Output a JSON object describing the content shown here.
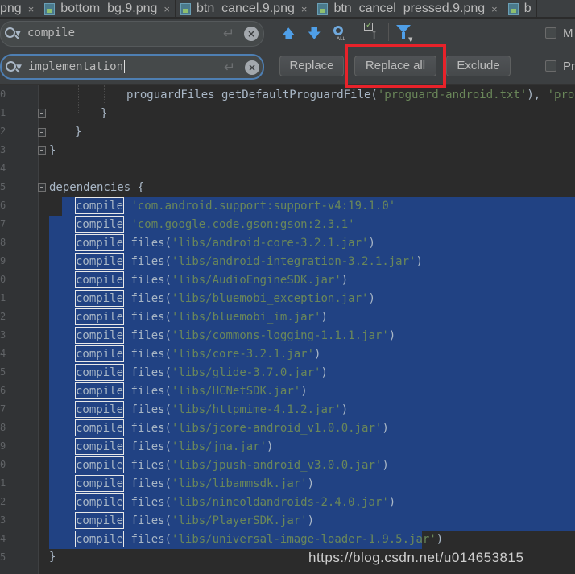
{
  "tabs": [
    {
      "label": "png",
      "has_icon": false
    },
    {
      "label": "bottom_bg.9.png",
      "has_icon": true
    },
    {
      "label": "btn_cancel.9.png",
      "has_icon": true
    },
    {
      "label": "btn_cancel_pressed.9.png",
      "has_icon": true
    },
    {
      "label": "b",
      "has_icon": true
    }
  ],
  "search": {
    "find_value": "compile",
    "replace_value": "implementation",
    "replace_button": "Replace",
    "replace_all_button": "Replace all",
    "exclude_button": "Exclude",
    "match_case_label": "M",
    "preserve_case_label": "Pr"
  },
  "gutter": {
    "line_numbers": [
      "0",
      "1",
      "2",
      "3",
      "4",
      "5",
      "6",
      "7",
      "8",
      "9",
      "0",
      "1",
      "2",
      "3",
      "4",
      "5",
      "6",
      "7",
      "8",
      "9",
      "0",
      "1",
      "2",
      "3",
      "4",
      "5"
    ]
  },
  "code": {
    "proguard_line": {
      "prefix": "proguardFiles getDefaultProguardFile(",
      "arg1": "'proguard-android.txt'",
      "sep": "), ",
      "arg2": "'proguar"
    },
    "close_brace_inner": "}",
    "close_brace_mid": "}",
    "close_brace_outer": "}",
    "dependencies_open": "dependencies {",
    "deps_keyword": "compile",
    "deps": [
      {
        "type": "string",
        "value": "'com.android.support:support-v4:19.1.0'"
      },
      {
        "type": "string",
        "value": "'com.google.code.gson:gson:2.3.1'"
      },
      {
        "type": "files",
        "value": "'libs/android-core-3.2.1.jar'"
      },
      {
        "type": "files",
        "value": "'libs/android-integration-3.2.1.jar'"
      },
      {
        "type": "files",
        "value": "'libs/AudioEngineSDK.jar'"
      },
      {
        "type": "files",
        "value": "'libs/bluemobi_exception.jar'"
      },
      {
        "type": "files",
        "value": "'libs/bluemobi_im.jar'"
      },
      {
        "type": "files",
        "value": "'libs/commons-logging-1.1.1.jar'"
      },
      {
        "type": "files",
        "value": "'libs/core-3.2.1.jar'"
      },
      {
        "type": "files",
        "value": "'libs/glide-3.7.0.jar'"
      },
      {
        "type": "files",
        "value": "'libs/HCNetSDK.jar'"
      },
      {
        "type": "files",
        "value": "'libs/httpmime-4.1.2.jar'"
      },
      {
        "type": "files",
        "value": "'libs/jcore-android_v1.0.0.jar'"
      },
      {
        "type": "files",
        "value": "'libs/jna.jar'"
      },
      {
        "type": "files",
        "value": "'libs/jpush-android_v3.0.0.jar'"
      },
      {
        "type": "files",
        "value": "'libs/libammsdk.jar'"
      },
      {
        "type": "files",
        "value": "'libs/nineoldandroids-2.4.0.jar'"
      },
      {
        "type": "files",
        "value": "'libs/PlayerSDK.jar'"
      },
      {
        "type": "files",
        "value": "'libs/universal-image-loader-1.9.5.jar'"
      }
    ],
    "files_keyword": "files(",
    "files_close": ")",
    "dependencies_close": "}"
  },
  "watermark": "https://blog.csdn.net/u014653815",
  "colors": {
    "selection": "#214283",
    "string": "#6a8759",
    "text": "#a9b7c6",
    "highlight_frame": "#e8222a"
  }
}
